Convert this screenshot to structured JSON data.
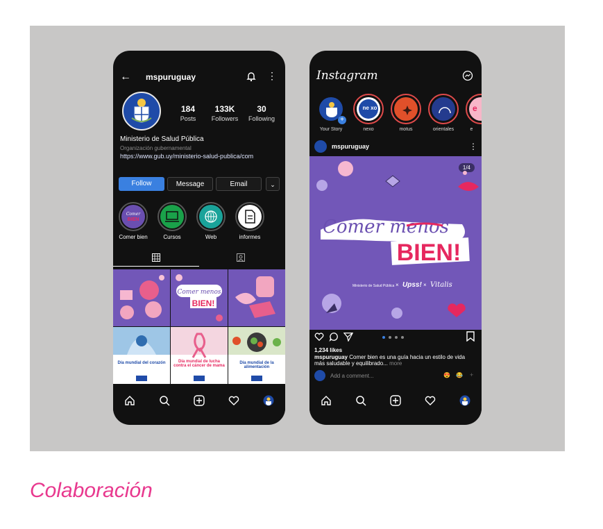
{
  "caption": "Colaboración",
  "profile": {
    "username": "mspuruguay",
    "back_icon": "arrow-left-icon",
    "stats": [
      {
        "num": "184",
        "label": "Posts"
      },
      {
        "num": "133K",
        "label": "Followers"
      },
      {
        "num": "30",
        "label": "Following"
      }
    ],
    "name": "Ministerio de Salud Pública",
    "category": "Organización gubernamental",
    "link": "https://www.gub.uy/ministerio-salud-publica/com",
    "buttons": {
      "follow": "Follow",
      "message": "Message",
      "email": "Email",
      "more": "⌄"
    },
    "highlights": [
      "Comer bien",
      "Cursos",
      "Web",
      "informes"
    ],
    "highlight_colors": [
      "#6a4fb0",
      "#1aa14a",
      "#1aa39a",
      "#ffffff"
    ],
    "tiles": [
      {
        "title": "",
        "color": "#7257b8"
      },
      {
        "title": "Comer menos BIEN!",
        "color": "#7257b8"
      },
      {
        "title": "",
        "color": "#7257b8"
      },
      {
        "title": "Día mundial del corazón",
        "color": "#ffffff"
      },
      {
        "title": "Día mundial de lucha contra el cáncer de mama",
        "color": "#ffffff"
      },
      {
        "title": "Día mundial de la alimentación",
        "color": "#ffffff"
      }
    ]
  },
  "feed": {
    "logo": "Instagram",
    "stories": [
      {
        "label": "Your Story",
        "color": "#1f4ba8"
      },
      {
        "label": "nexo",
        "color": "#1f4ba8",
        "text": "ne xo"
      },
      {
        "label": "motus",
        "color": "#e0502a"
      },
      {
        "label": "orientales",
        "color": "#243b8e"
      },
      {
        "label": "e",
        "color": "#f7b6c8",
        "text": "e"
      }
    ],
    "post_user": "mspuruguay",
    "counter": "1/4",
    "post_title_1": "Comer menos",
    "post_title_2": "BIEN!",
    "post_partners": [
      "Ministerio de Salud Pública",
      "×",
      "Upss!",
      "×",
      "Vitalis"
    ],
    "likes": "1,234 likes",
    "caption_user": "mspuruguay",
    "caption_text": " Comer bien es una guía hacia un estilo de vida más saludable y equilibrado...",
    "caption_more": "more",
    "comment_placeholder": "Add a comment...",
    "reactions": [
      "😍",
      "😂",
      "+"
    ]
  },
  "colors": {
    "accent": "#e8388e",
    "follow": "#3a80e0",
    "post_bg": "#7257b8",
    "bien": "#e6285f"
  }
}
